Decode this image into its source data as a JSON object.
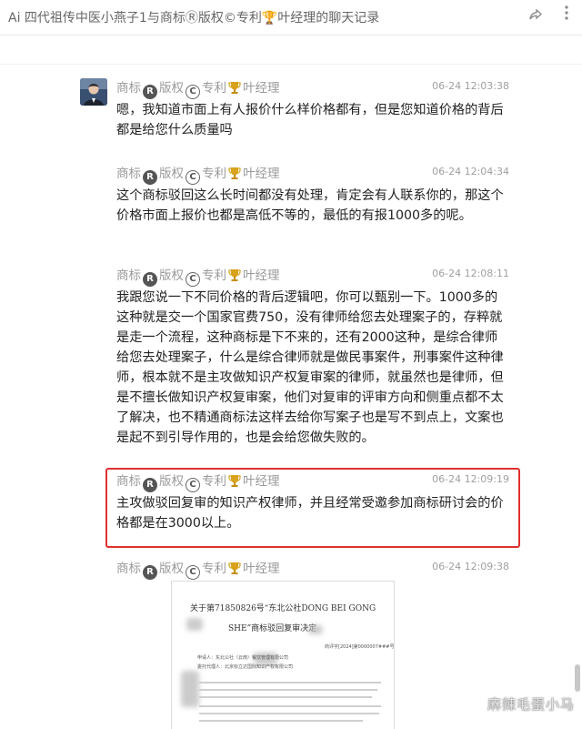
{
  "window": {
    "title": "Ai 四代祖传中医小燕子1与商标Ⓡ版权©专利🏆叶经理的聊天记录",
    "share_icon": "share-icon",
    "more_icon": "more-icon"
  },
  "sender": {
    "name_prefix": "商标",
    "reg_symbol": "R",
    "name_mid": "版权",
    "copy_symbol": "C",
    "name_mid2": "专利",
    "name_suffix": "叶经理"
  },
  "messages": [
    {
      "time": "06-24 12:03:38",
      "text": "嗯，我知道市面上有人报价什么样价格都有，但是您知道价格的背后都是给您什么质量吗"
    },
    {
      "time": "06-24 12:04:34",
      "text": "这个商标驳回这么长时间都没有处理，肯定会有人联系你的，那这个价格市面上报价也都是高低不等的，最低的有报1000多的呢。"
    },
    {
      "time": "06-24 12:08:11",
      "text": "我跟您说一下不同价格的背后逻辑吧，你可以甄别一下。1000多的这种就是交一个国家官费750，没有律师给您去处理案子的，存粹就是走一个流程，这种商标是下不来的，还有2000这种，是综合律师给您去处理案子，什么是综合律师就是做民事案件，刑事案件这种律师，根本就不是主攻做知识产权复审案的律师，就虽然也是律师，但是不擅长做知识产权复审案，他们对复审的评审方向和侧重点都不太了解决，也不精通商标法这样去给你写案子也是写不到点上，文案也是起不到引导作用的，也是会给您做失败的。"
    },
    {
      "time": "06-24 12:09:19",
      "text": "主攻做驳回复审的知识产权律师，并且经常受邀参加商标研讨会的价格都是在3000以上。"
    },
    {
      "time": "06-24 12:09:38",
      "text": ""
    }
  ],
  "document": {
    "title_line1": "关于第71850826号“东北公社DONG BEI GONG",
    "title_line2": "SHE”商标驳回复审决定",
    "ref_no": "商评字[2024]第0000007###号",
    "applicant_label": "申请人：东北公社（云南）餐饮管理有限公司",
    "agent_label": "委托代理人：北京标立达国际知识产权有限公司"
  },
  "watermark": "麻辣毛蛋小马",
  "colors": {
    "highlight_border": "#e0302f",
    "name_gray": "#9a9a9a",
    "text": "#222222"
  }
}
